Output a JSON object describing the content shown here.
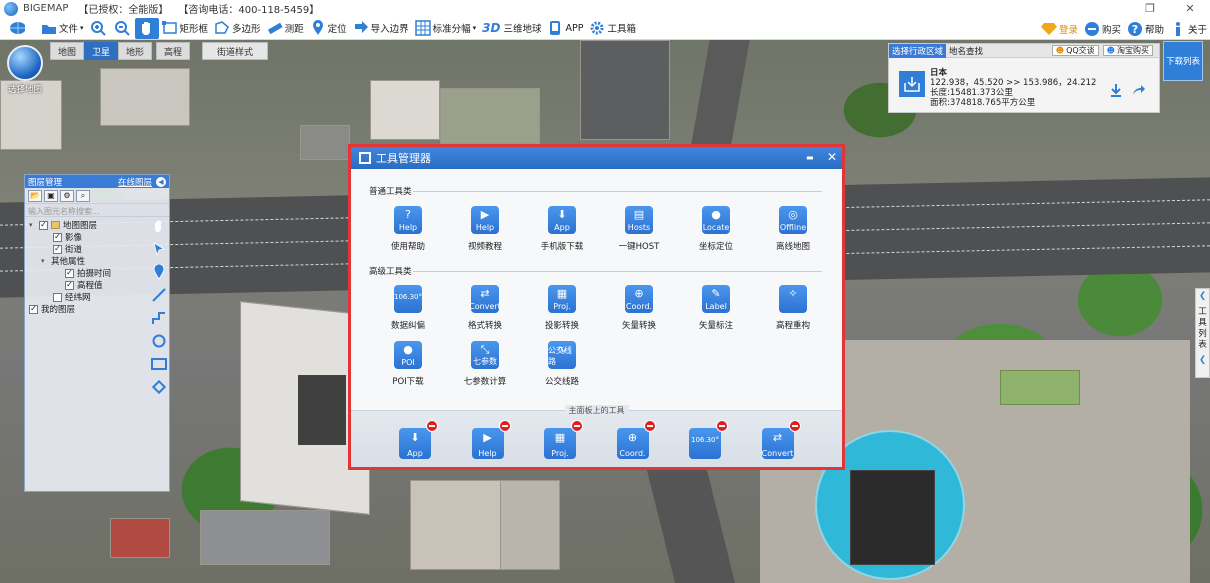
{
  "window": {
    "app_name": "BIGEMAP",
    "license": "【已授权：全能版】",
    "phone": "【咨询电话：400-118-5459】",
    "restore_glyph": "❐",
    "close_glyph": "✕"
  },
  "toolbar": {
    "file": "文件",
    "rect_box": "矩形框",
    "polygon": "多边形",
    "measure": "测距",
    "locate": "定位",
    "import_border": "导入边界",
    "standard_tile": "标准分幅",
    "three_d": "3D",
    "globe": "三维地球",
    "app": "APP",
    "toolbox": "工具箱",
    "login": "登录",
    "buy": "购买",
    "help": "帮助",
    "about": "关于"
  },
  "map_tabs": [
    "地图",
    "卫星",
    "地形",
    "高程",
    "街道样式"
  ],
  "select_map_label": "选择地图",
  "layer_panel": {
    "title": "图层管理",
    "online_label": "在线图层",
    "search_placeholder": "输入图元名称搜索...",
    "tree": [
      {
        "label": "地图图层",
        "checked": true,
        "level": 0,
        "folder": true,
        "toggle": "▾"
      },
      {
        "label": "影像",
        "checked": true,
        "level": 2
      },
      {
        "label": "街道",
        "checked": true,
        "level": 2
      },
      {
        "label": "其他属性",
        "checked": false,
        "level": 1,
        "toggle": "▾",
        "nocb": true
      },
      {
        "label": "拍摄时间",
        "checked": true,
        "level": 3
      },
      {
        "label": "高程值",
        "checked": true,
        "level": 3
      },
      {
        "label": "经纬网",
        "checked": false,
        "level": 2
      },
      {
        "label": "我的图层",
        "checked": true,
        "level": 0
      }
    ]
  },
  "region_panel": {
    "tab_active": "选择行政区域",
    "tab_search": "地名查找",
    "qq": "QQ交谈",
    "taobao": "淘宝购买",
    "region_name": "日本",
    "coords": "122.938，45.520 >> 153.986，24.212",
    "length": "长度:15481.373公里",
    "area": "面积:374818.765平方公里"
  },
  "download_list": "下载列表",
  "tool_list_vertical": "工具列表",
  "dialog": {
    "title": "工具管理器",
    "min_glyph": "▬",
    "close_glyph": "✕",
    "section_common": "普通工具类",
    "section_advanced": "高级工具类",
    "common_tools": [
      {
        "icon": "Help",
        "glyph": "?",
        "label": "使用帮助"
      },
      {
        "icon": "Help",
        "glyph": "▶",
        "label": "视频教程"
      },
      {
        "icon": "App",
        "glyph": "⬇",
        "label": "手机版下载"
      },
      {
        "icon": "Hosts",
        "glyph": "▤",
        "label": "一键HOST"
      },
      {
        "icon": "Locate",
        "glyph": "●",
        "label": "坐标定位"
      },
      {
        "icon": "Offline",
        "glyph": "◎",
        "label": "离线地图"
      }
    ],
    "advanced_tools": [
      {
        "icon": "",
        "glyph": "106.30°",
        "label": "数据纠偏"
      },
      {
        "icon": "Convert",
        "glyph": "⇄",
        "label": "格式转换"
      },
      {
        "icon": "Proj.",
        "glyph": "▦",
        "label": "投影转换"
      },
      {
        "icon": "Coord.",
        "glyph": "⊕",
        "label": "矢量转换"
      },
      {
        "icon": "Label",
        "glyph": "✎",
        "label": "矢量标注"
      },
      {
        "icon": "",
        "glyph": "✧",
        "label": "高程重构"
      },
      {
        "icon": "POI",
        "glyph": "●",
        "label": "POI下载"
      },
      {
        "icon": "七参数",
        "glyph": "⤡",
        "label": "七参数计算"
      },
      {
        "icon": "公交线路",
        "glyph": "∿",
        "label": "公交线路"
      }
    ],
    "panel_title": "主面板上的工具",
    "panel_tools": [
      {
        "icon": "App",
        "glyph": "⬇"
      },
      {
        "icon": "Help",
        "glyph": "▶"
      },
      {
        "icon": "Proj.",
        "glyph": "▦"
      },
      {
        "icon": "Coord.",
        "glyph": "⊕"
      },
      {
        "icon": "",
        "glyph": "106.30°"
      },
      {
        "icon": "Convert",
        "glyph": "⇄"
      }
    ]
  }
}
